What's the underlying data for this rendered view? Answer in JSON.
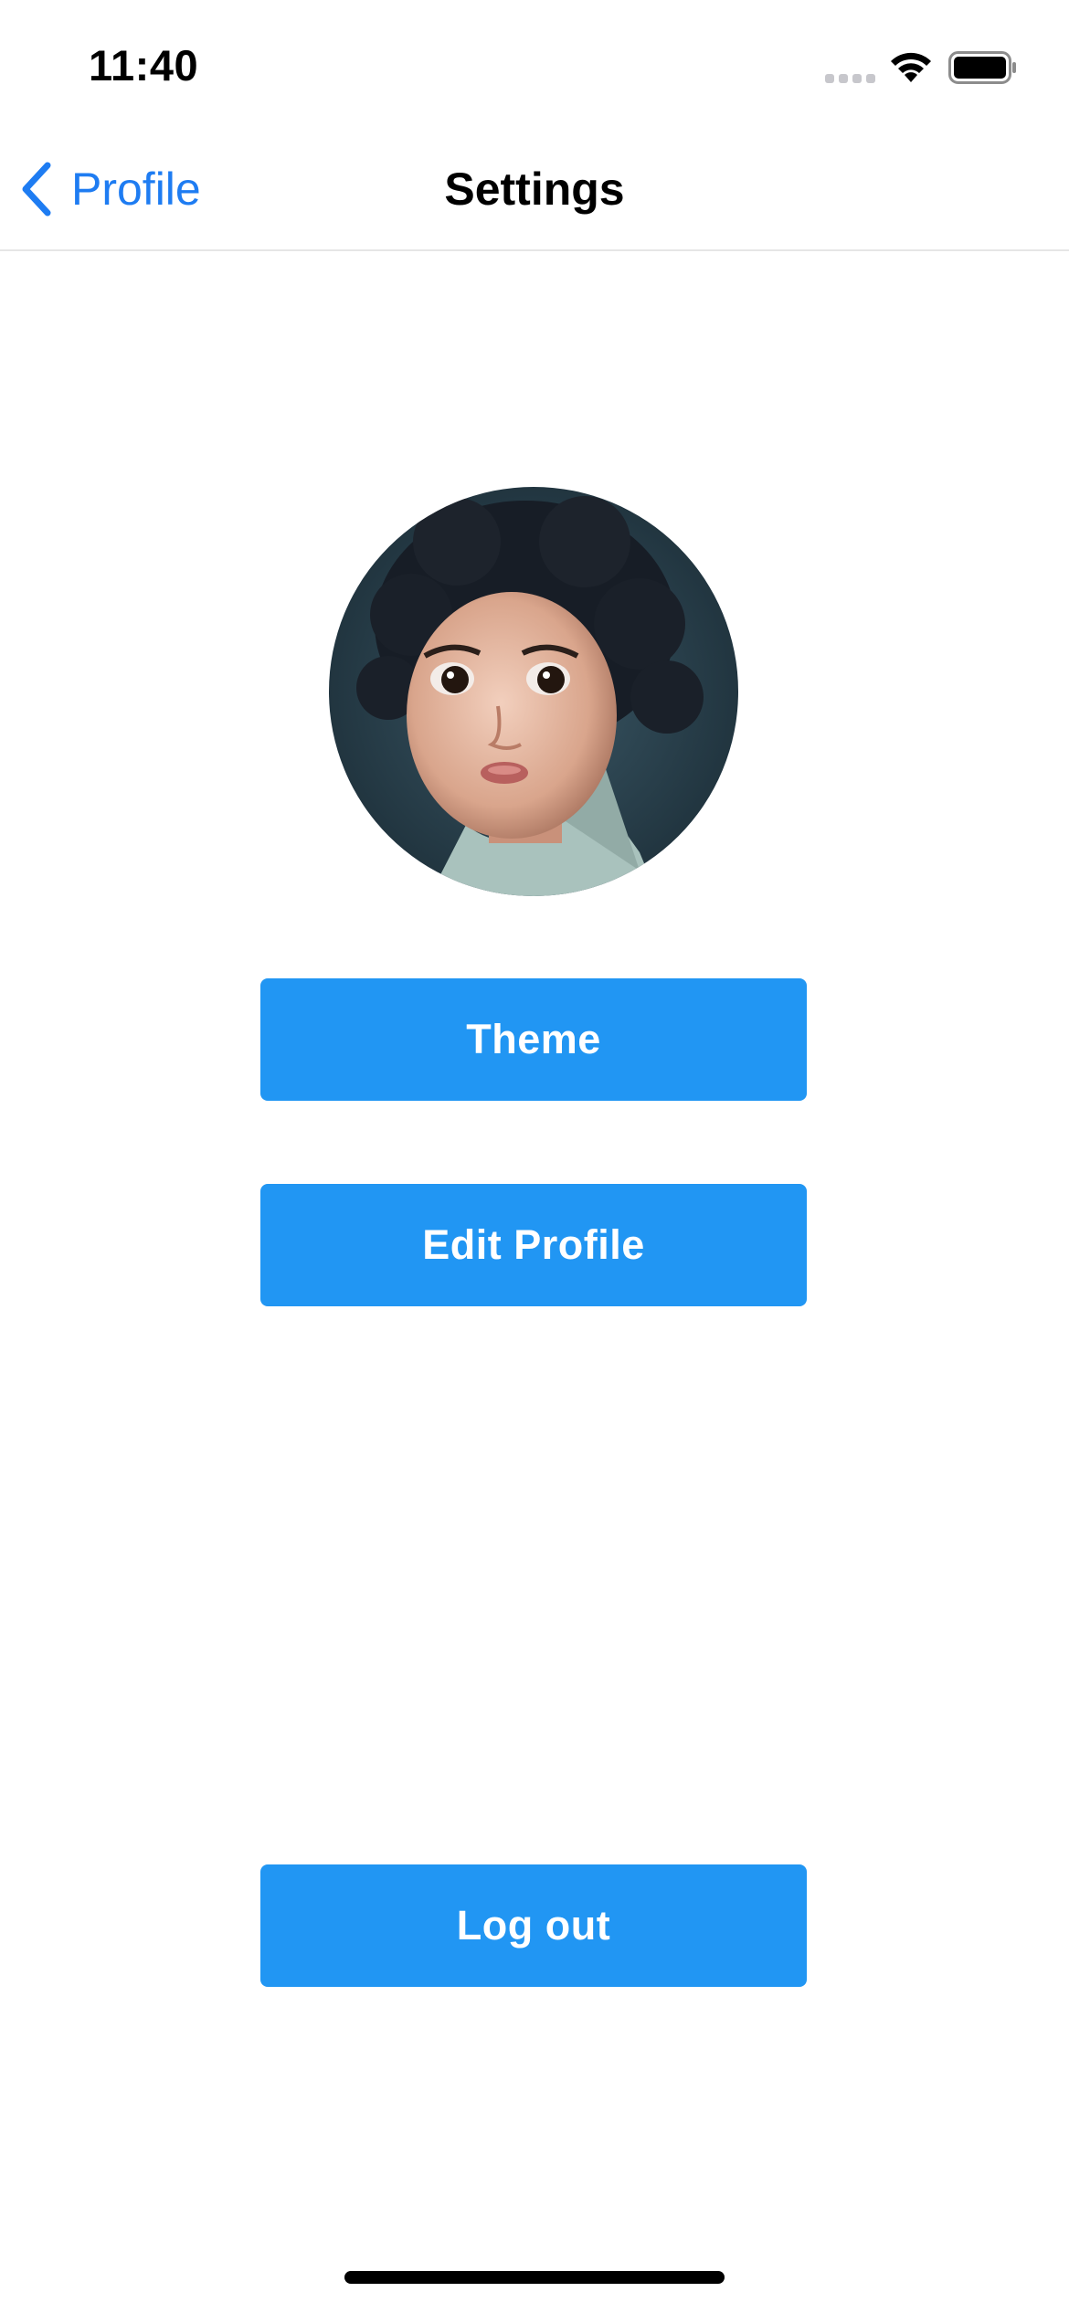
{
  "status_bar": {
    "time": "11:40",
    "icons": [
      "signal-icon",
      "wifi-icon",
      "battery-icon"
    ]
  },
  "nav": {
    "back_label": "Profile",
    "title": "Settings",
    "back_icon": "chevron-left-icon"
  },
  "avatar": {
    "icon": "avatar"
  },
  "buttons": {
    "theme": "Theme",
    "edit_profile": "Edit Profile",
    "log_out": "Log out"
  },
  "colors": {
    "accent": "#1e7cf2",
    "button_bg": "#2196f3",
    "button_text": "#ffffff"
  }
}
